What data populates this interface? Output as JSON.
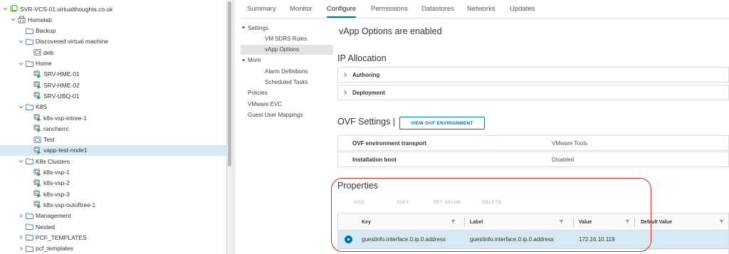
{
  "tree": {
    "nodes": [
      {
        "label": "SVR-VCS-01.virtualthoughts.co.uk",
        "caret": "down",
        "icon": "vcenter-icon",
        "indent": 0
      },
      {
        "label": "Homelab",
        "caret": "down",
        "icon": "datacenter-icon",
        "indent": 1
      },
      {
        "label": "Backup",
        "caret": "",
        "icon": "folder-icon",
        "indent": 2
      },
      {
        "label": "Discovered virtual machine",
        "caret": "down",
        "icon": "folder-icon",
        "indent": 2
      },
      {
        "label": "deb",
        "caret": "",
        "icon": "vm-icon",
        "indent": 3
      },
      {
        "label": "Home",
        "caret": "down",
        "icon": "folder-icon",
        "indent": 2
      },
      {
        "label": "SRV-HME-01",
        "caret": "",
        "icon": "vm-running-icon",
        "indent": 3
      },
      {
        "label": "SRV-HME-02",
        "caret": "",
        "icon": "vm-running-icon",
        "indent": 3
      },
      {
        "label": "SRV-UBQ-01",
        "caret": "",
        "icon": "vm-running-icon",
        "indent": 3
      },
      {
        "label": "K8S",
        "caret": "down",
        "icon": "folder-icon",
        "indent": 2
      },
      {
        "label": "k8s-vsp-intree-1",
        "caret": "",
        "icon": "vm-running-icon",
        "indent": 3
      },
      {
        "label": "rancherrc",
        "caret": "",
        "icon": "vm-running-icon",
        "indent": 3
      },
      {
        "label": "Test",
        "caret": "",
        "icon": "vm-icon",
        "indent": 3
      },
      {
        "label": "vapp-test-node1",
        "caret": "",
        "icon": "vm-running-icon",
        "indent": 3,
        "selected": true
      },
      {
        "label": "K8s Clusters",
        "caret": "down",
        "icon": "folder-icon",
        "indent": 2
      },
      {
        "label": "k8s-vsp-1",
        "caret": "",
        "icon": "vm-running-icon",
        "indent": 3
      },
      {
        "label": "k8s-vsp-2",
        "caret": "",
        "icon": "vm-running-icon",
        "indent": 3
      },
      {
        "label": "k8s-vsp-3",
        "caret": "",
        "icon": "vm-running-icon",
        "indent": 3
      },
      {
        "label": "k8s-vsp-outoftree-1",
        "caret": "",
        "icon": "vm-running-icon",
        "indent": 3
      },
      {
        "label": "Management",
        "caret": "right",
        "icon": "folder-icon",
        "indent": 2
      },
      {
        "label": "Nested",
        "caret": "",
        "icon": "folder-icon",
        "indent": 2
      },
      {
        "label": "PCF_TEMPLATES",
        "caret": "right",
        "icon": "folder-icon",
        "indent": 2
      },
      {
        "label": "pcf_templates",
        "caret": "right",
        "icon": "folder-icon",
        "indent": 2
      }
    ]
  },
  "tabs": [
    {
      "label": "Summary"
    },
    {
      "label": "Monitor"
    },
    {
      "label": "Configure",
      "active": true
    },
    {
      "label": "Permissions"
    },
    {
      "label": "Datastores"
    },
    {
      "label": "Networks"
    },
    {
      "label": "Updates"
    }
  ],
  "settings_nav": [
    {
      "label": "Settings",
      "caret": "down",
      "indent": 0
    },
    {
      "label": "VM SDRS Rules",
      "caret": "",
      "indent": 1
    },
    {
      "label": "vApp Options",
      "caret": "",
      "indent": 1,
      "selected": true
    },
    {
      "label": "More",
      "caret": "down",
      "indent": 0
    },
    {
      "label": "Alarm Definitions",
      "caret": "",
      "indent": 1
    },
    {
      "label": "Scheduled Tasks",
      "caret": "",
      "indent": 1
    },
    {
      "label": "Policies",
      "caret": "",
      "indent": 0
    },
    {
      "label": "VMware EVC",
      "caret": "",
      "indent": 0
    },
    {
      "label": "Guest User Mappings",
      "caret": "",
      "indent": 0
    }
  ],
  "main": {
    "vapp_status": "vApp Options are enabled",
    "ip_allocation_title": "IP Allocation",
    "authoring_label": "Authoring",
    "deployment_label": "Deployment",
    "ovf_settings_title": "OVF Settings |",
    "view_ovf_button": "VIEW OVF ENVIRONMENT",
    "ovf_rows": [
      {
        "key": "OVF environment transport",
        "value": "VMware Tools"
      },
      {
        "key": "Installation boot",
        "value": "Disabled"
      }
    ],
    "properties_title": "Properties",
    "actions": {
      "add": "ADD",
      "edit": "EDIT",
      "set_value": "SET VALUE",
      "delete": "DELETE"
    },
    "table": {
      "columns": [
        "Key",
        "Label",
        "Value",
        "Default Value"
      ],
      "rows": [
        {
          "key": "guestinfo.interface.0.ip.0.address",
          "label": "guestinfo.interface.0.ip.0.address",
          "value": "172.16.10.119",
          "default_value": ""
        }
      ]
    }
  },
  "colors": {
    "accent": "#0072a3",
    "selection": "#d6e9f5",
    "annotation": "#e2211c"
  }
}
